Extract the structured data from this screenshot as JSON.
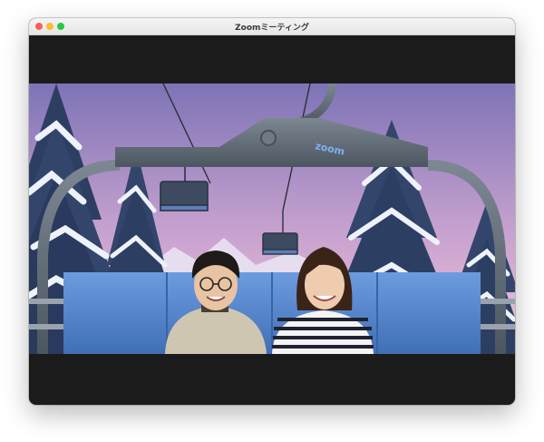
{
  "window": {
    "title": "Zoomミーティング"
  },
  "virtual_background": {
    "chairlift_logo": "zoom"
  },
  "colors": {
    "sky_top": "#7e73b6",
    "sky_bottom": "#f3c3d8",
    "seat_blue": "#4d7ec4",
    "lift_gray": "#56606b"
  }
}
